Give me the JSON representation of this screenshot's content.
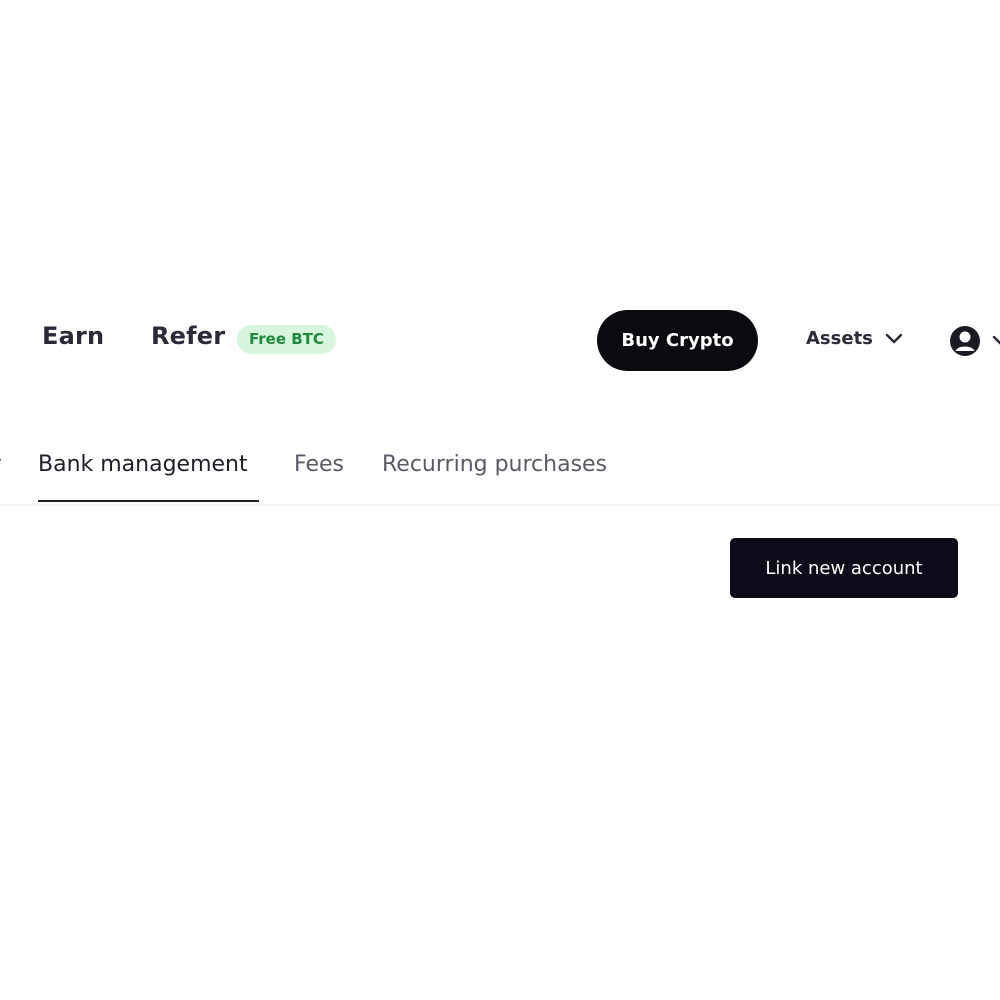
{
  "header": {
    "nav_items": [
      {
        "label": "Earn"
      },
      {
        "label": "Refer"
      }
    ],
    "promo_badge": "Free BTC",
    "buy_button_label": "Buy Crypto",
    "assets_menu_label": "Assets",
    "icons": {
      "assets_chevron": "chevron-down-icon",
      "account": "user-circle-icon",
      "account_chevron": "chevron-down-icon"
    }
  },
  "tabs": {
    "partial_label": "r",
    "items": [
      {
        "label": "Bank management",
        "active": true
      },
      {
        "label": "Fees",
        "active": false
      },
      {
        "label": "Recurring purchases",
        "active": false
      }
    ]
  },
  "main": {
    "link_account_label": "Link new account"
  },
  "colors": {
    "primary_button": "#0b0b0f",
    "badge_bg": "#d6f5dc",
    "badge_text": "#1f8a3c",
    "active_tab_underline": "#1f1f2a"
  }
}
